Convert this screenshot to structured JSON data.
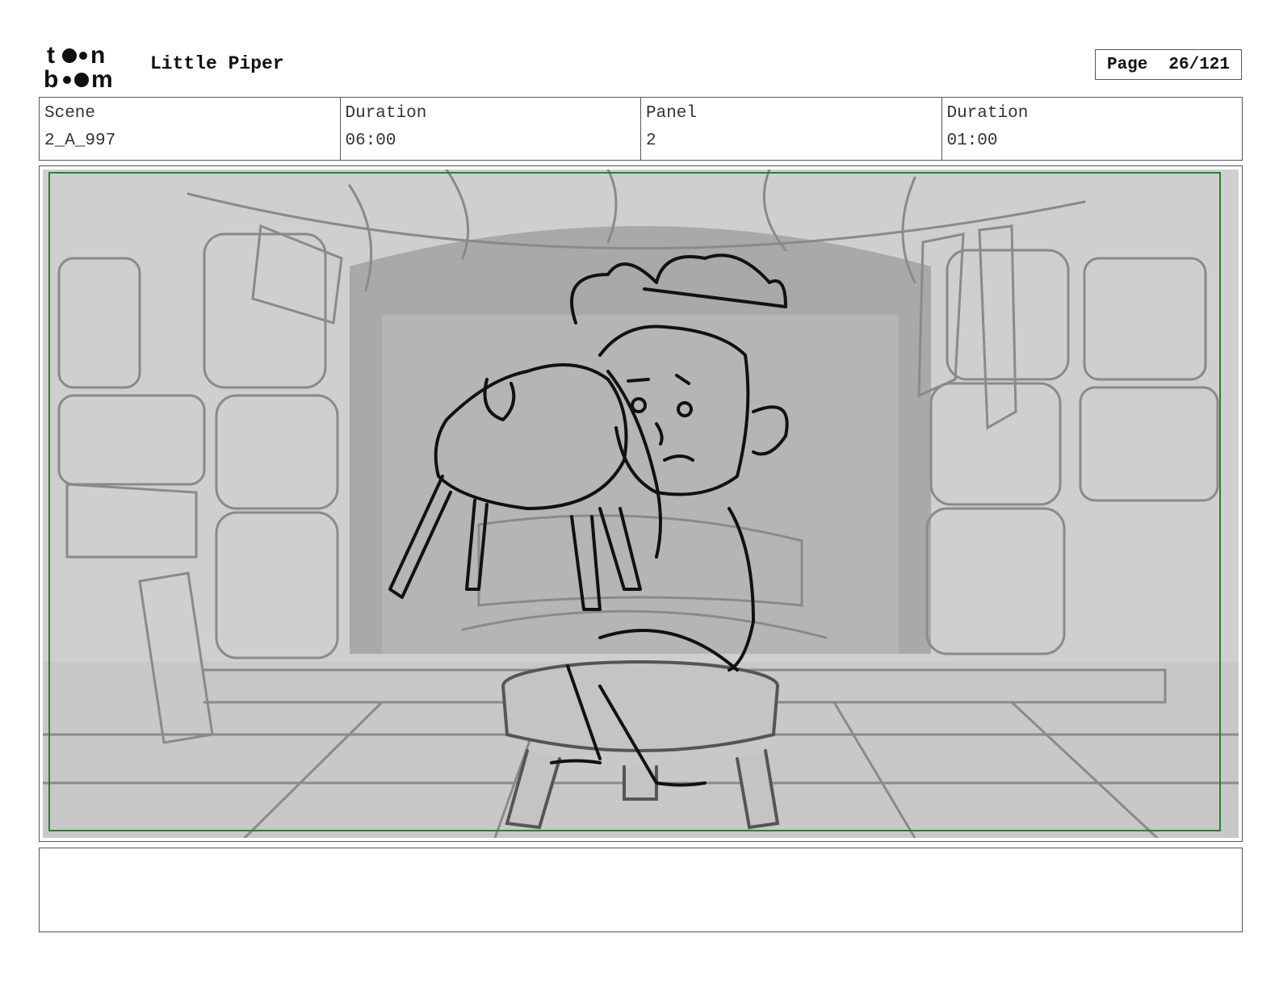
{
  "header": {
    "logo_text_top": "toon",
    "logo_text_bottom": "boom",
    "project_title": "Little Piper",
    "page_label": "Page",
    "page_number": "26/121"
  },
  "info": {
    "scene_label": "Scene",
    "scene_value": "2_A_997",
    "scene_duration_label": "Duration",
    "scene_duration_value": "06:00",
    "panel_label": "Panel",
    "panel_value": "2",
    "panel_duration_label": "Duration",
    "panel_duration_value": "01:00"
  },
  "notes": {
    "text": ""
  },
  "colors": {
    "safe_frame": "#2e7d32",
    "sketch_bg": "#cfcfcf",
    "sketch_line": "#111111"
  }
}
